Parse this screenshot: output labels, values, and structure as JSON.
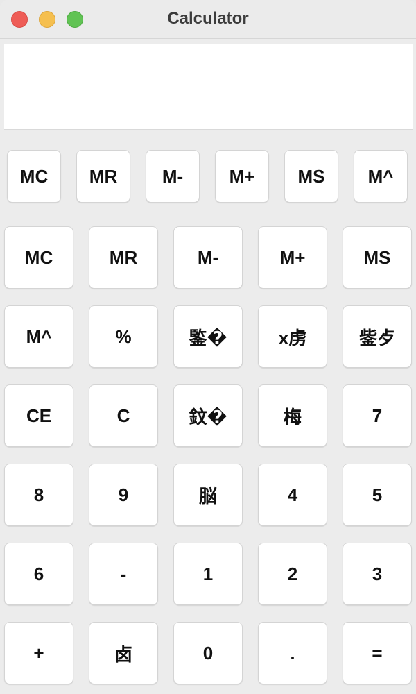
{
  "window": {
    "title": "Calculator"
  },
  "display": {
    "value": ""
  },
  "memory_row": [
    "MC",
    "MR",
    "M-",
    "M+",
    "MS",
    "M^"
  ],
  "keypad_rows": [
    [
      "MC",
      "MR",
      "M-",
      "M+",
      "MS"
    ],
    [
      "M^",
      "%",
      "鍳�",
      "x虏",
      "鈭歺"
    ],
    [
      "CE",
      "C",
      "鈫�",
      "梅",
      "7"
    ],
    [
      "8",
      "9",
      "脳",
      "4",
      "5"
    ],
    [
      "6",
      "-",
      "1",
      "2",
      "3"
    ],
    [
      "+",
      "卤",
      "0",
      ".",
      "="
    ]
  ],
  "colors": {
    "close": "#ee5c56",
    "minimize": "#f5bf4f",
    "zoom": "#61c354",
    "button_bg": "#ffffff",
    "window_bg": "#ececec"
  }
}
